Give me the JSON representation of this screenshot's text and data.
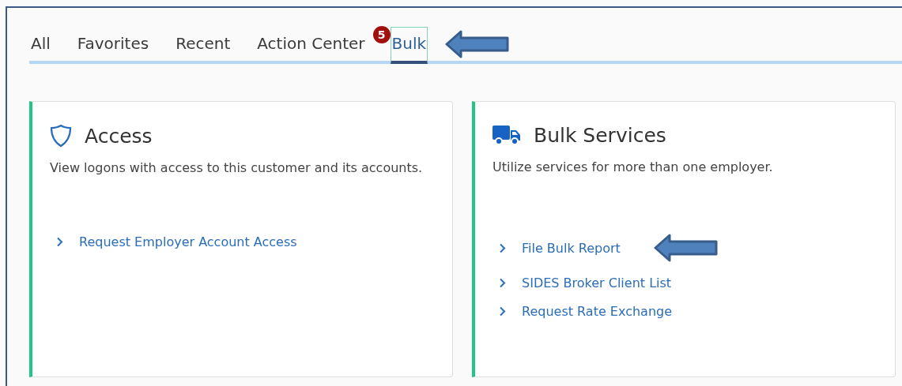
{
  "tabs": [
    {
      "label": "All",
      "selected": false,
      "pointed": false
    },
    {
      "label": "Favorites",
      "selected": false,
      "pointed": false
    },
    {
      "label": "Recent",
      "selected": false,
      "pointed": false
    },
    {
      "label": "Action Center",
      "selected": false,
      "pointed": false,
      "badge": "5"
    },
    {
      "label": "Bulk",
      "selected": true,
      "pointed": true
    }
  ],
  "cards": [
    {
      "kind": "shield",
      "title": "Access",
      "description": "View logons with access to this customer and its accounts.",
      "links": [
        {
          "label": "Request Employer Account Access",
          "pointed": false
        }
      ]
    },
    {
      "kind": "truck",
      "title": "Bulk Services",
      "description": "Utilize services for more than one employer.",
      "links": [
        {
          "label": "File Bulk Report",
          "pointed": true
        },
        {
          "label": "SIDES Broker Client List",
          "pointed": false
        },
        {
          "label": "Request Rate Exchange",
          "pointed": false
        }
      ]
    }
  ]
}
